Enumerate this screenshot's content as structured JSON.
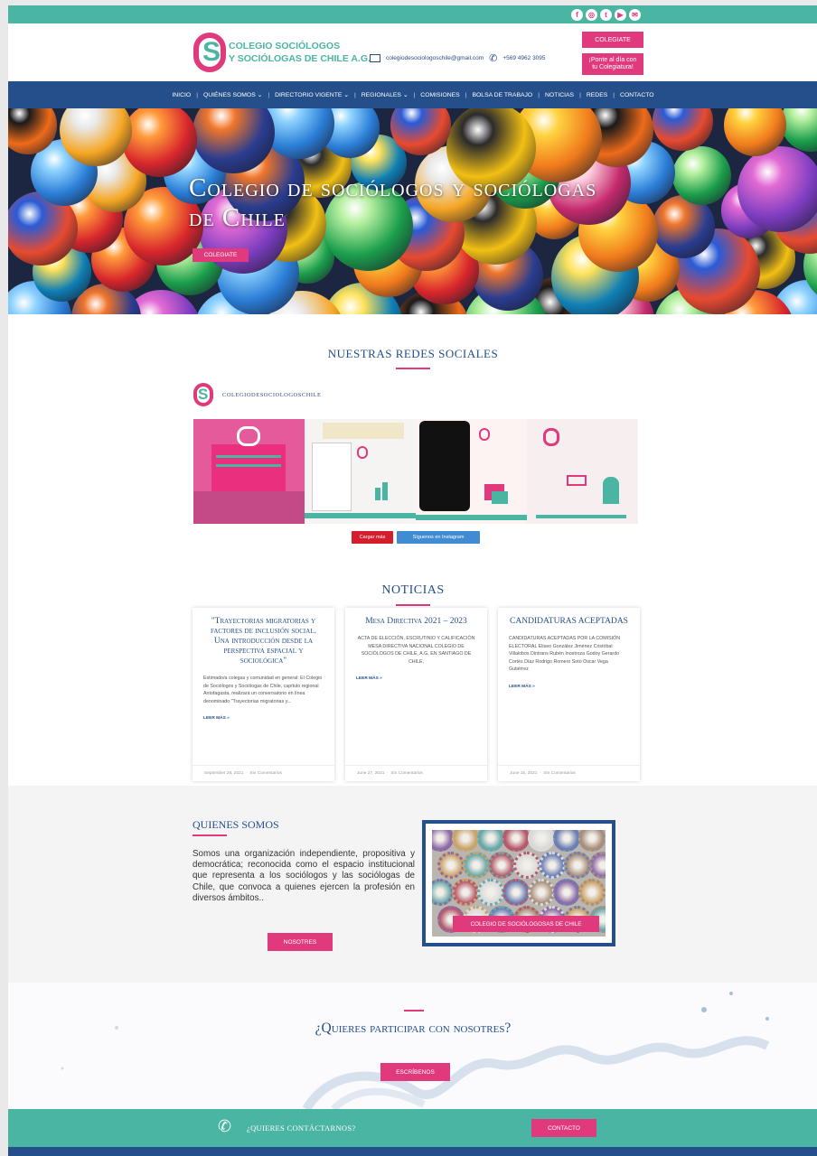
{
  "colors": {
    "teal": "#4bb5a3",
    "pink": "#e03a7d",
    "navy": "#244f8a"
  },
  "social_icons": [
    "facebook-icon",
    "instagram-icon",
    "twitter-icon",
    "youtube-icon",
    "email-icon"
  ],
  "header": {
    "logo_line1": "COLEGIO SOCIÓLOGOS",
    "logo_line2": "Y SOCIÓLOGAS DE CHILE A.G.",
    "email": "colegiodesociologoschile@gmail.com",
    "phone": "+569 4962 3095",
    "btn_colegiate": "COLEGIATE",
    "btn_ponte": "¡Ponte al día con tu Colegiatura!"
  },
  "nav": [
    "INICIO",
    "QUIÉNES SOMOS ⌄",
    "DIRECTORIO VIGENTE ⌄",
    "REGIONALES ⌄",
    "COMISIONES",
    "BOLSA DE TRABAJO",
    "NOTICIAS",
    "REDES",
    "CONTACTO"
  ],
  "hero": {
    "title": "Colegio de sociólogos y sociólogas de Chile",
    "button": "COLEGIATE"
  },
  "social": {
    "title": "NUESTRAS REDES SOCIALES",
    "account": "COLEGIODESOCIOLOGOSCHILE",
    "load_more": "Cargar más",
    "follow": "Síguenos en Instagram"
  },
  "news": {
    "title": "NOTICIAS",
    "items": [
      {
        "title": "\"Trayectorias migratorias y factores de inclusión social. Una introducción desde la perspectiva espacial y sociológica\"",
        "body": "Estimado/a colegas y comunidad en general: El Colegio de Sociólogos y Sociólogas de Chile, capítulo regional Antofagasta, realizará un conversatorio en línea denominado \"Trayectorias migratorias y...",
        "more": "LEER MÁS »",
        "date": "September 28, 2021",
        "comments": "Sin Comentarios"
      },
      {
        "title": "Mesa Directiva 2021 – 2023",
        "body": "ACTA DE ELECCIÓN, ESCRUTINIO Y CALIFICACIÓN MESA DIRECTIVA NACIONAL COLEGIO DE SOCIÓLOGOS DE CHILE, A.G. EN SANTIAGO DE CHILE,",
        "more": "LEER MÁS »",
        "date": "June 27, 2021",
        "comments": "Sin Comentarios"
      },
      {
        "title": "CANDIDATURAS ACEPTADAS",
        "body": "CANDIDATURAS ACEPTADAS POR LA COMISIÓN ELECTORAL Eliseo González Jiménez Cristóbal Villalobos Dintrans Rubén Inostroza Godoy Gerardo Cortés Díaz Rodrigo Romero Soto Oscar Vega Gutiérrez",
        "more": "LEER MÁS »",
        "date": "June 15, 2021",
        "comments": "Sin Comentarios"
      }
    ]
  },
  "about": {
    "title": "QUIENES SOMOS",
    "text": "Somos una organización independiente, propositiva y democrática; reconocida como el espacio institucional que representa a los sociólogos y las sociólogas de Chile, que convoca a quienes ejercen la profesión en diversos ámbitos..",
    "button": "NOSOTRES",
    "caption": "COLEGIO DE SOCIÓLOGOSAS DE CHILE"
  },
  "join": {
    "title": "¿Quieres participar con nosotres?",
    "button": "ESCRÍBENOS"
  },
  "footer": {
    "text": "¿QUIERES CONTÁCTARNOS?",
    "button": "CONTACTO"
  }
}
